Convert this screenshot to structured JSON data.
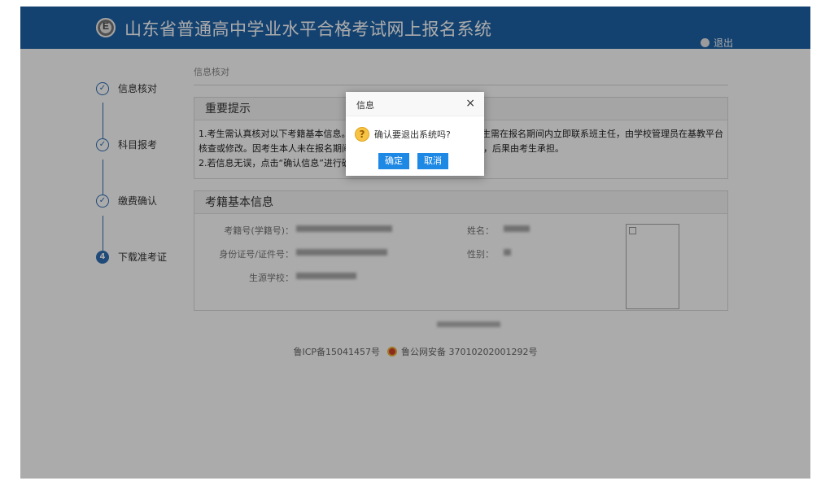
{
  "header": {
    "title": "山东省普通高中学业水平合格考试网上报名系统",
    "logout_label": "退出"
  },
  "steps": [
    {
      "label": "信息核对",
      "marker": "✓"
    },
    {
      "label": "科目报考",
      "marker": "✓"
    },
    {
      "label": "缴费确认",
      "marker": "✓"
    },
    {
      "label": "下载准考证",
      "marker": "4"
    }
  ],
  "main": {
    "section_title": "信息核对",
    "notice": {
      "title": "重要提示",
      "line1": "1.考生需认真核对以下考籍基本信息。若",
      "line1_right": "考生需在报名期间内立即联系班主任，由学校管理员在基教平台",
      "line2": "核查或修改。因考生本人未在报名期间",
      "line2_right": "试的，后果由考生承担。",
      "line3": "2.若信息无误，点击“确认信息”进行确"
    },
    "info": {
      "title": "考籍基本信息",
      "student_id_label": "考籍号(学籍号)：",
      "id_card_label": "身份证号/证件号：",
      "school_label": "生源学校：",
      "name_label": "姓名：",
      "gender_label": "性别："
    }
  },
  "footer": {
    "icp": "鲁ICP备15041457号",
    "police": "鲁公网安备 37010202001292号"
  },
  "dialog": {
    "title": "信息",
    "close": "×",
    "message": "确认要退出系统吗?",
    "confirm_label": "确定",
    "cancel_label": "取消",
    "icon_glyph": "?"
  },
  "colors": {
    "header_bg": "#1e63a8",
    "accent": "#2f6fb5",
    "button": "#1e88e5"
  }
}
